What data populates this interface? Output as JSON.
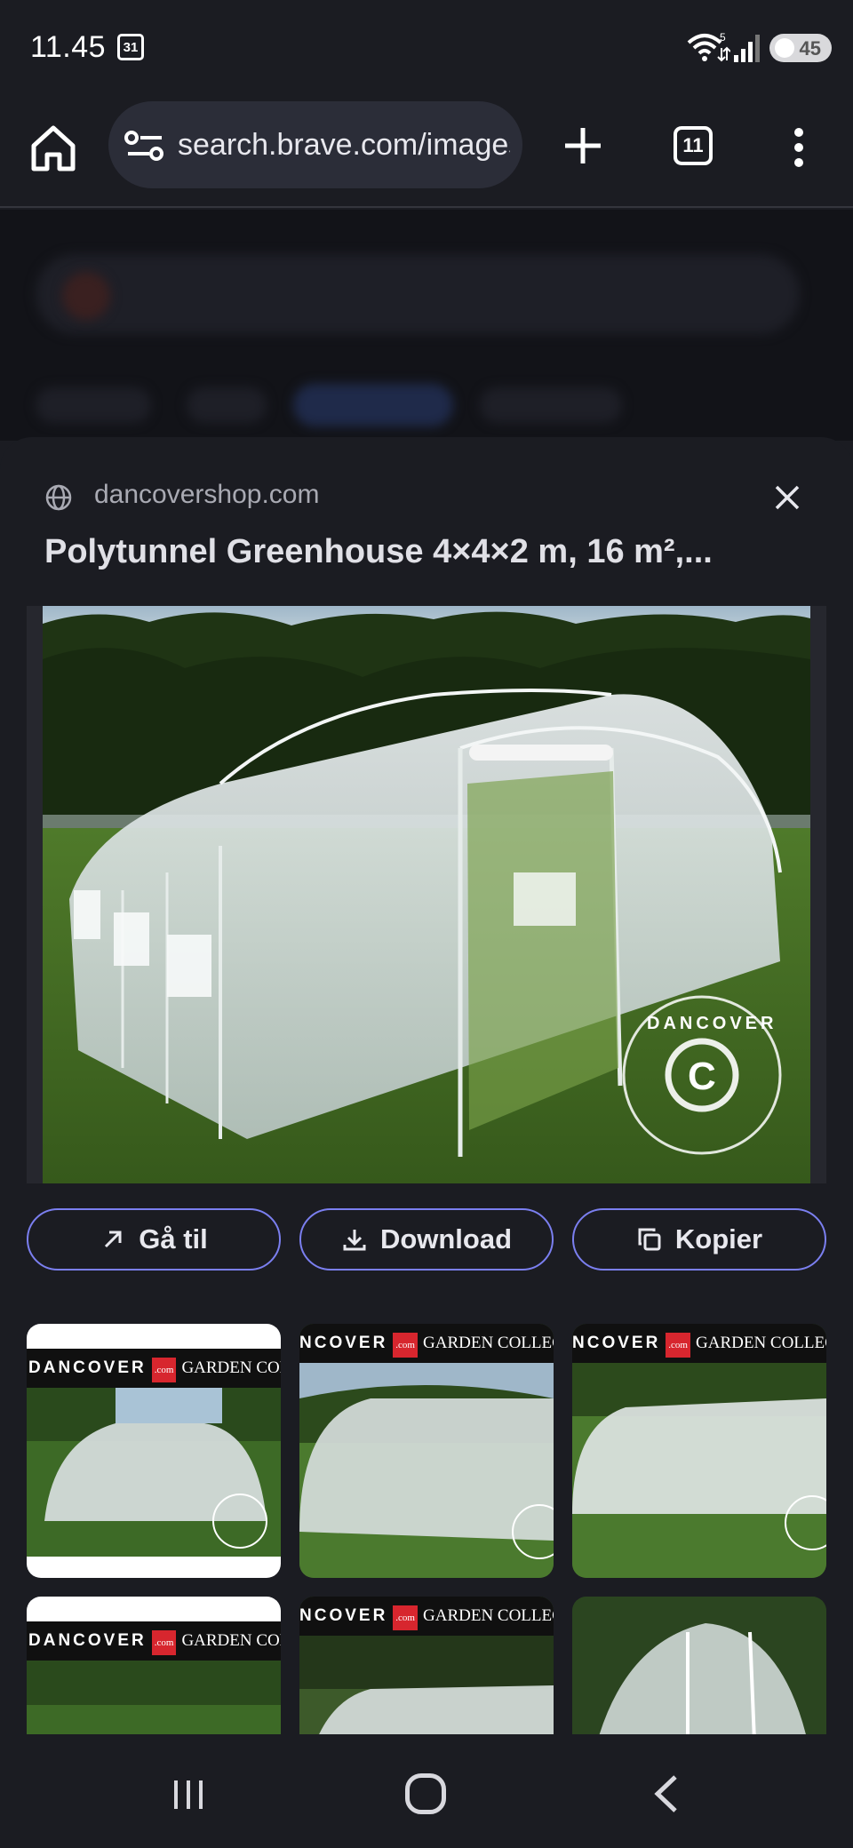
{
  "status": {
    "time": "11.45",
    "calendar_day": "31",
    "wifi_badge": "5",
    "battery": "45"
  },
  "browser": {
    "url": "search.brave.com/images",
    "tab_count": "11"
  },
  "sheet": {
    "source": "dancovershop.com",
    "title": "Polytunnel Greenhouse 4×4×2 m, 16 m²,...",
    "watermark": "DANCOVER",
    "actions": {
      "goto": "Gå til",
      "download": "Download",
      "copy": "Kopier"
    }
  },
  "thumbnails": [
    {
      "brand": "DANCOVER",
      "badge": ".com",
      "collection": "GARDEN COLLECTION"
    },
    {
      "brand": "NCOVER",
      "badge": ".com",
      "collection": "GARDEN COLLECT"
    },
    {
      "brand": "NCOVER",
      "badge": ".com",
      "collection": "GARDEN COLLECT"
    },
    {
      "brand": "DANCOVER",
      "badge": ".com",
      "collection": "GARDEN COLLECTION"
    },
    {
      "brand": "NCOVER",
      "badge": ".com",
      "collection": "GARDEN COLLECT"
    },
    {
      "brand": "",
      "badge": "",
      "collection": ""
    }
  ],
  "colors": {
    "accent": "#7b7ff0",
    "background": "#1b1c22",
    "url_box": "#2b2d38"
  }
}
